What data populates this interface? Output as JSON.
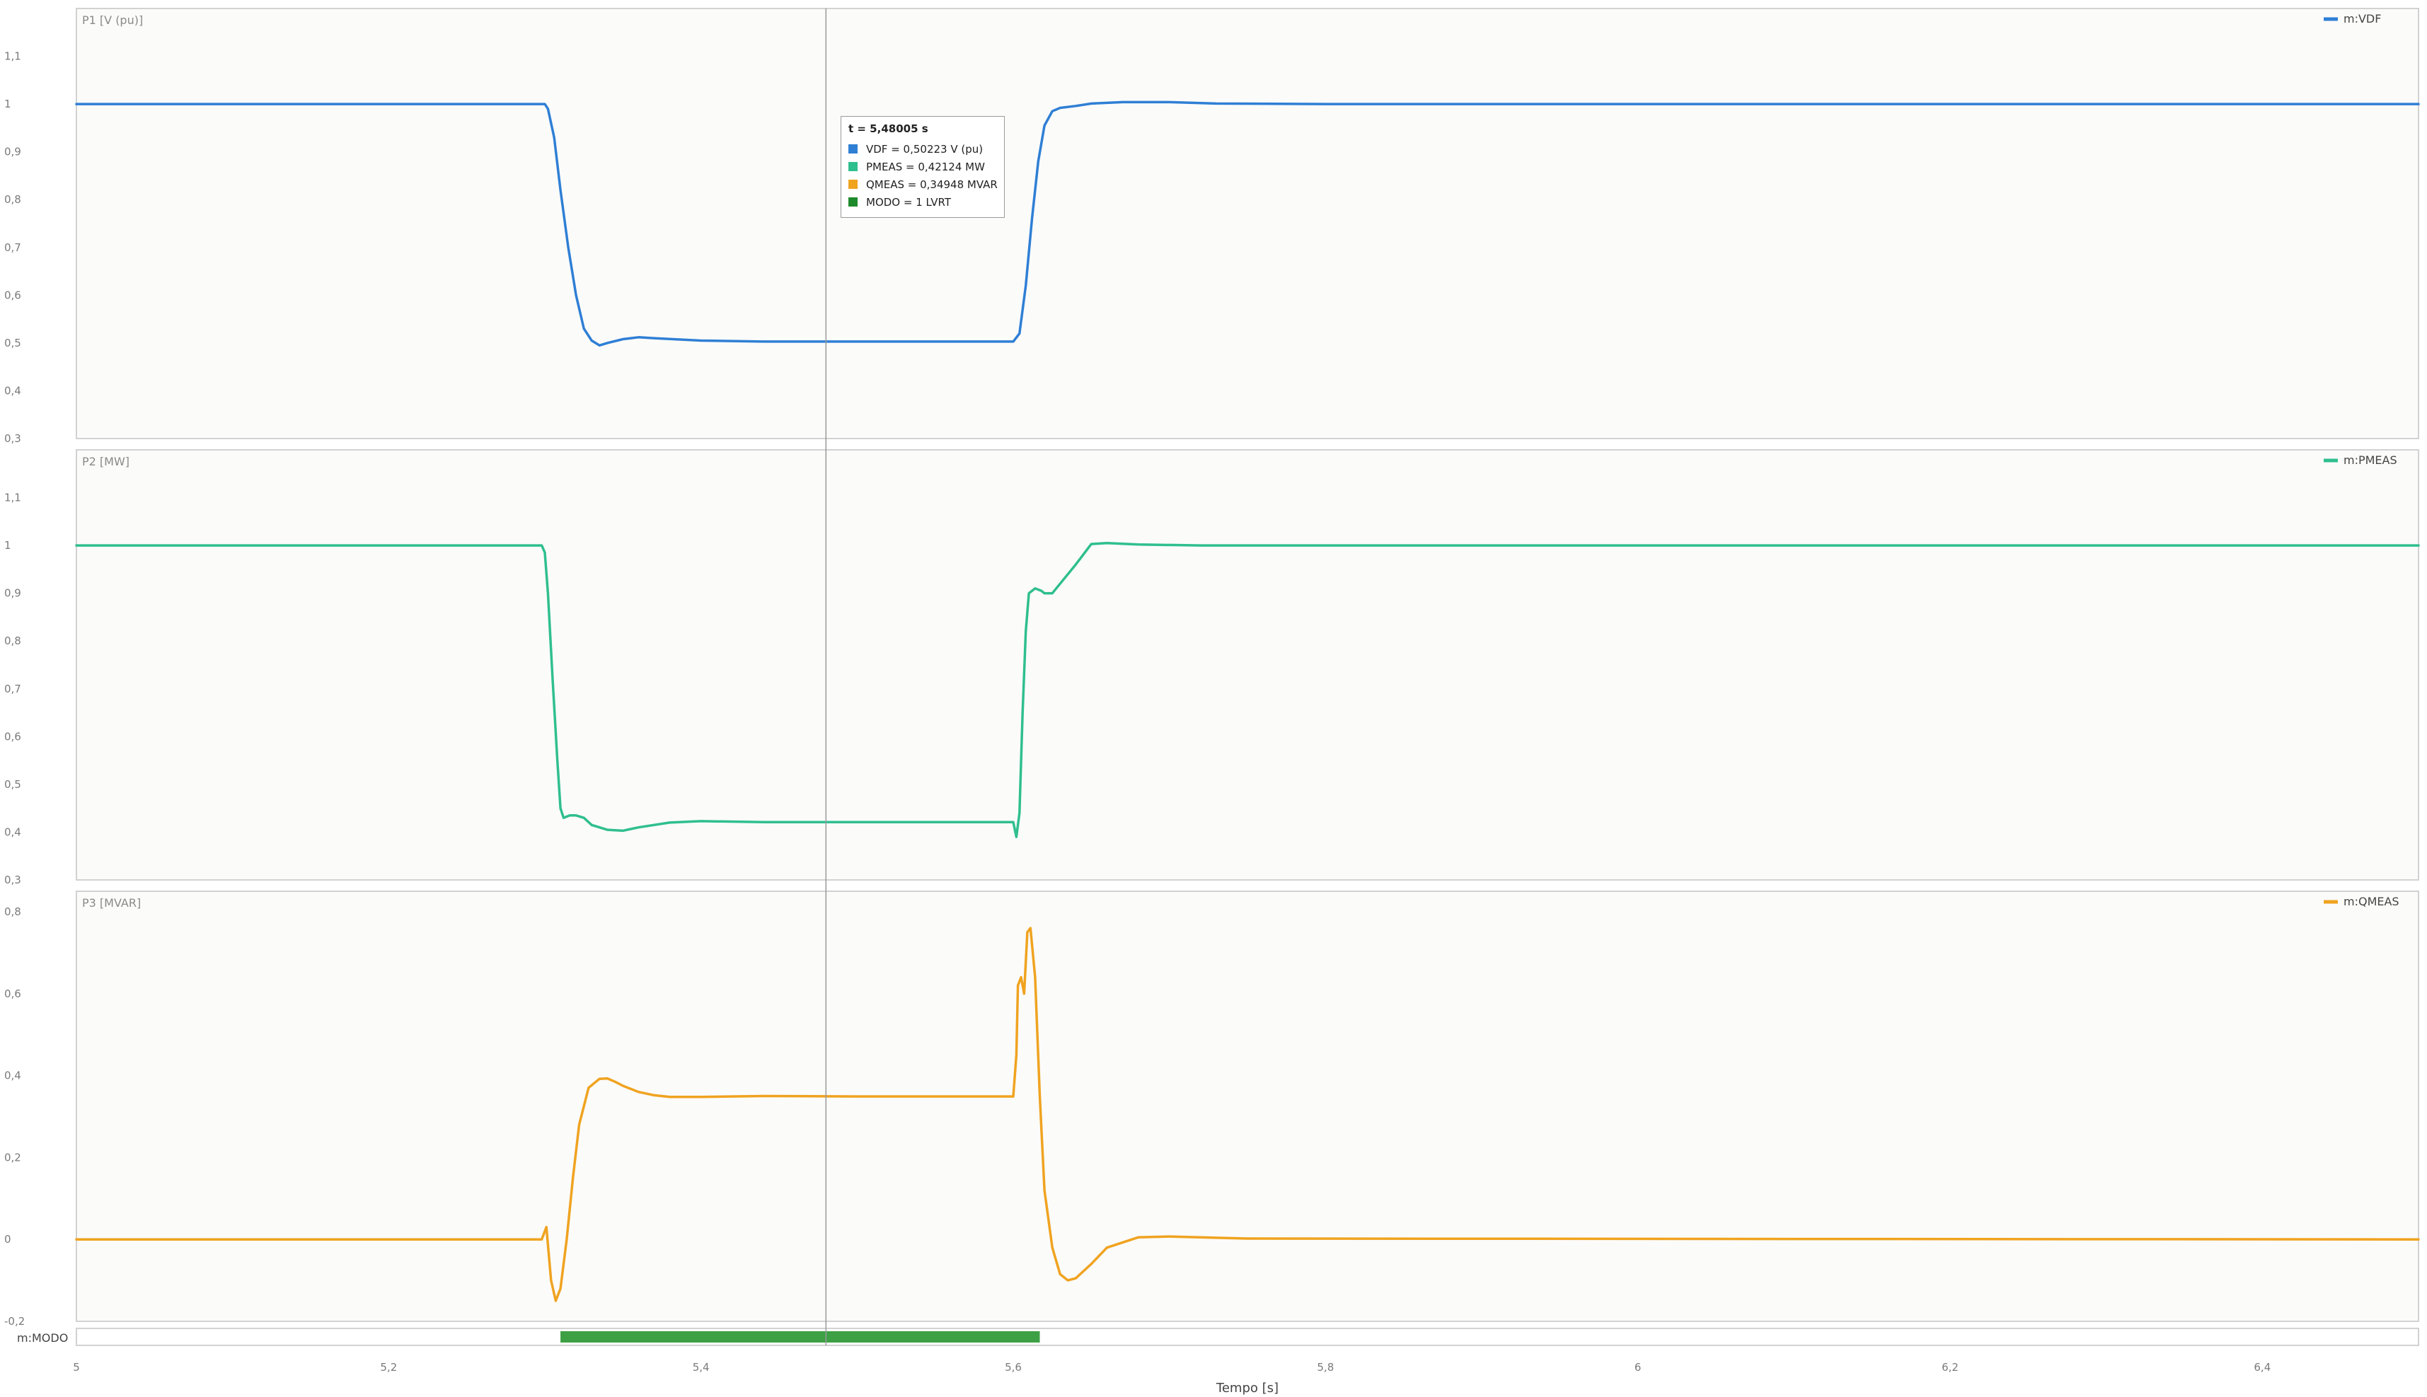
{
  "tooltip": {
    "title": "t = 5,48005 s",
    "rows": [
      {
        "label": "VDF = 0,50223 V (pu)",
        "color": "#2f7fd5"
      },
      {
        "label": "PMEAS = 0,42124 MW",
        "color": "#2fbf8f"
      },
      {
        "label": "QMEAS = 0,34948 MVAR",
        "color": "#f0a320"
      },
      {
        "label": "MODO = 1 LVRT",
        "color": "#1e8a2c"
      }
    ]
  },
  "chart_data": {
    "type": "line",
    "xlabel": "Tempo [s]",
    "xlim": [
      5.0,
      6.5
    ],
    "xticks": [
      {
        "v": 5.0,
        "label": "5"
      },
      {
        "v": 5.2,
        "label": "5,2"
      },
      {
        "v": 5.4,
        "label": "5,4"
      },
      {
        "v": 5.6,
        "label": "5,6"
      },
      {
        "v": 5.8,
        "label": "5,8"
      },
      {
        "v": 6.0,
        "label": "6"
      },
      {
        "v": 6.2,
        "label": "6,2"
      },
      {
        "v": 6.4,
        "label": "6,4"
      }
    ],
    "cursor_x": 5.48005,
    "grid": false,
    "legend_position": "top-right",
    "panels": [
      {
        "title": "P1 [V (pu)]",
        "ylim": [
          0.3,
          1.2
        ],
        "yticks": [
          {
            "v": 1.1,
            "label": "1,1"
          },
          {
            "v": 1.0,
            "label": "1"
          },
          {
            "v": 0.9,
            "label": "0,9"
          },
          {
            "v": 0.8,
            "label": "0,8"
          },
          {
            "v": 0.7,
            "label": "0,7"
          },
          {
            "v": 0.6,
            "label": "0,6"
          },
          {
            "v": 0.5,
            "label": "0,5"
          },
          {
            "v": 0.4,
            "label": "0,4"
          },
          {
            "v": 0.3,
            "label": "0,3"
          }
        ],
        "series": [
          {
            "name": "m:VDF",
            "color": "#2f7fd5",
            "x": [
              5.0,
              5.3,
              5.302,
              5.306,
              5.31,
              5.315,
              5.32,
              5.325,
              5.33,
              5.335,
              5.34,
              5.35,
              5.36,
              5.37,
              5.4,
              5.44,
              5.5,
              5.6,
              5.604,
              5.608,
              5.612,
              5.616,
              5.62,
              5.625,
              5.63,
              5.64,
              5.65,
              5.67,
              5.7,
              5.73,
              5.8,
              6.5
            ],
            "y": [
              1.0,
              1.0,
              0.99,
              0.93,
              0.82,
              0.7,
              0.6,
              0.53,
              0.505,
              0.495,
              0.5,
              0.508,
              0.512,
              0.51,
              0.505,
              0.503,
              0.503,
              0.503,
              0.52,
              0.62,
              0.76,
              0.88,
              0.955,
              0.985,
              0.992,
              0.996,
              1.001,
              1.004,
              1.004,
              1.001,
              1.0,
              1.0
            ]
          }
        ]
      },
      {
        "title": "P2 [MW]",
        "ylim": [
          0.3,
          1.2
        ],
        "yticks": [
          {
            "v": 1.1,
            "label": "1,1"
          },
          {
            "v": 1.0,
            "label": "1"
          },
          {
            "v": 0.9,
            "label": "0,9"
          },
          {
            "v": 0.8,
            "label": "0,8"
          },
          {
            "v": 0.7,
            "label": "0,7"
          },
          {
            "v": 0.6,
            "label": "0,6"
          },
          {
            "v": 0.5,
            "label": "0,5"
          },
          {
            "v": 0.4,
            "label": "0,4"
          },
          {
            "v": 0.3,
            "label": "0,3"
          }
        ],
        "series": [
          {
            "name": "m:PMEAS",
            "color": "#2fbf8f",
            "x": [
              5.0,
              5.298,
              5.3,
              5.302,
              5.305,
              5.308,
              5.31,
              5.312,
              5.316,
              5.32,
              5.325,
              5.33,
              5.34,
              5.35,
              5.36,
              5.38,
              5.4,
              5.44,
              5.5,
              5.6,
              5.602,
              5.604,
              5.606,
              5.608,
              5.61,
              5.614,
              5.618,
              5.62,
              5.625,
              5.63,
              5.64,
              5.65,
              5.66,
              5.68,
              5.72,
              5.8,
              6.5
            ],
            "y": [
              1.0,
              1.0,
              0.985,
              0.9,
              0.72,
              0.55,
              0.45,
              0.43,
              0.435,
              0.435,
              0.43,
              0.415,
              0.405,
              0.403,
              0.41,
              0.42,
              0.423,
              0.421,
              0.421,
              0.421,
              0.39,
              0.44,
              0.65,
              0.82,
              0.9,
              0.91,
              0.905,
              0.9,
              0.9,
              0.92,
              0.96,
              1.003,
              1.005,
              1.002,
              1.0,
              1.0,
              1.0
            ]
          }
        ]
      },
      {
        "title": "P3 [MVAR]",
        "ylim": [
          -0.2,
          0.85
        ],
        "yticks": [
          {
            "v": 0.8,
            "label": "0,8"
          },
          {
            "v": 0.6,
            "label": "0,6"
          },
          {
            "v": 0.4,
            "label": "0,4"
          },
          {
            "v": 0.2,
            "label": "0,2"
          },
          {
            "v": 0.0,
            "label": "0"
          },
          {
            "v": -0.2,
            "label": "-0,2"
          }
        ],
        "series": [
          {
            "name": "m:QMEAS",
            "color": "#f0a320",
            "x": [
              5.0,
              5.298,
              5.301,
              5.304,
              5.307,
              5.31,
              5.314,
              5.318,
              5.322,
              5.328,
              5.335,
              5.34,
              5.345,
              5.35,
              5.36,
              5.37,
              5.38,
              5.4,
              5.44,
              5.5,
              5.6,
              5.602,
              5.603,
              5.605,
              5.607,
              5.609,
              5.611,
              5.614,
              5.617,
              5.62,
              5.625,
              5.63,
              5.635,
              5.64,
              5.65,
              5.66,
              5.68,
              5.7,
              5.75,
              6.5
            ],
            "y": [
              0.0,
              0.0,
              0.03,
              -0.1,
              -0.15,
              -0.12,
              0.0,
              0.15,
              0.28,
              0.37,
              0.392,
              0.393,
              0.385,
              0.375,
              0.36,
              0.352,
              0.348,
              0.348,
              0.35,
              0.349,
              0.349,
              0.45,
              0.62,
              0.64,
              0.6,
              0.75,
              0.76,
              0.64,
              0.35,
              0.12,
              -0.02,
              -0.085,
              -0.1,
              -0.095,
              -0.06,
              -0.02,
              0.005,
              0.007,
              0.002,
              0.0
            ]
          }
        ]
      }
    ],
    "modo_band": {
      "name": "m:MODO",
      "color": "#3da044",
      "segments": [
        {
          "start": 5.31,
          "end": 5.617,
          "value": 1,
          "label": "LVRT"
        }
      ]
    }
  }
}
